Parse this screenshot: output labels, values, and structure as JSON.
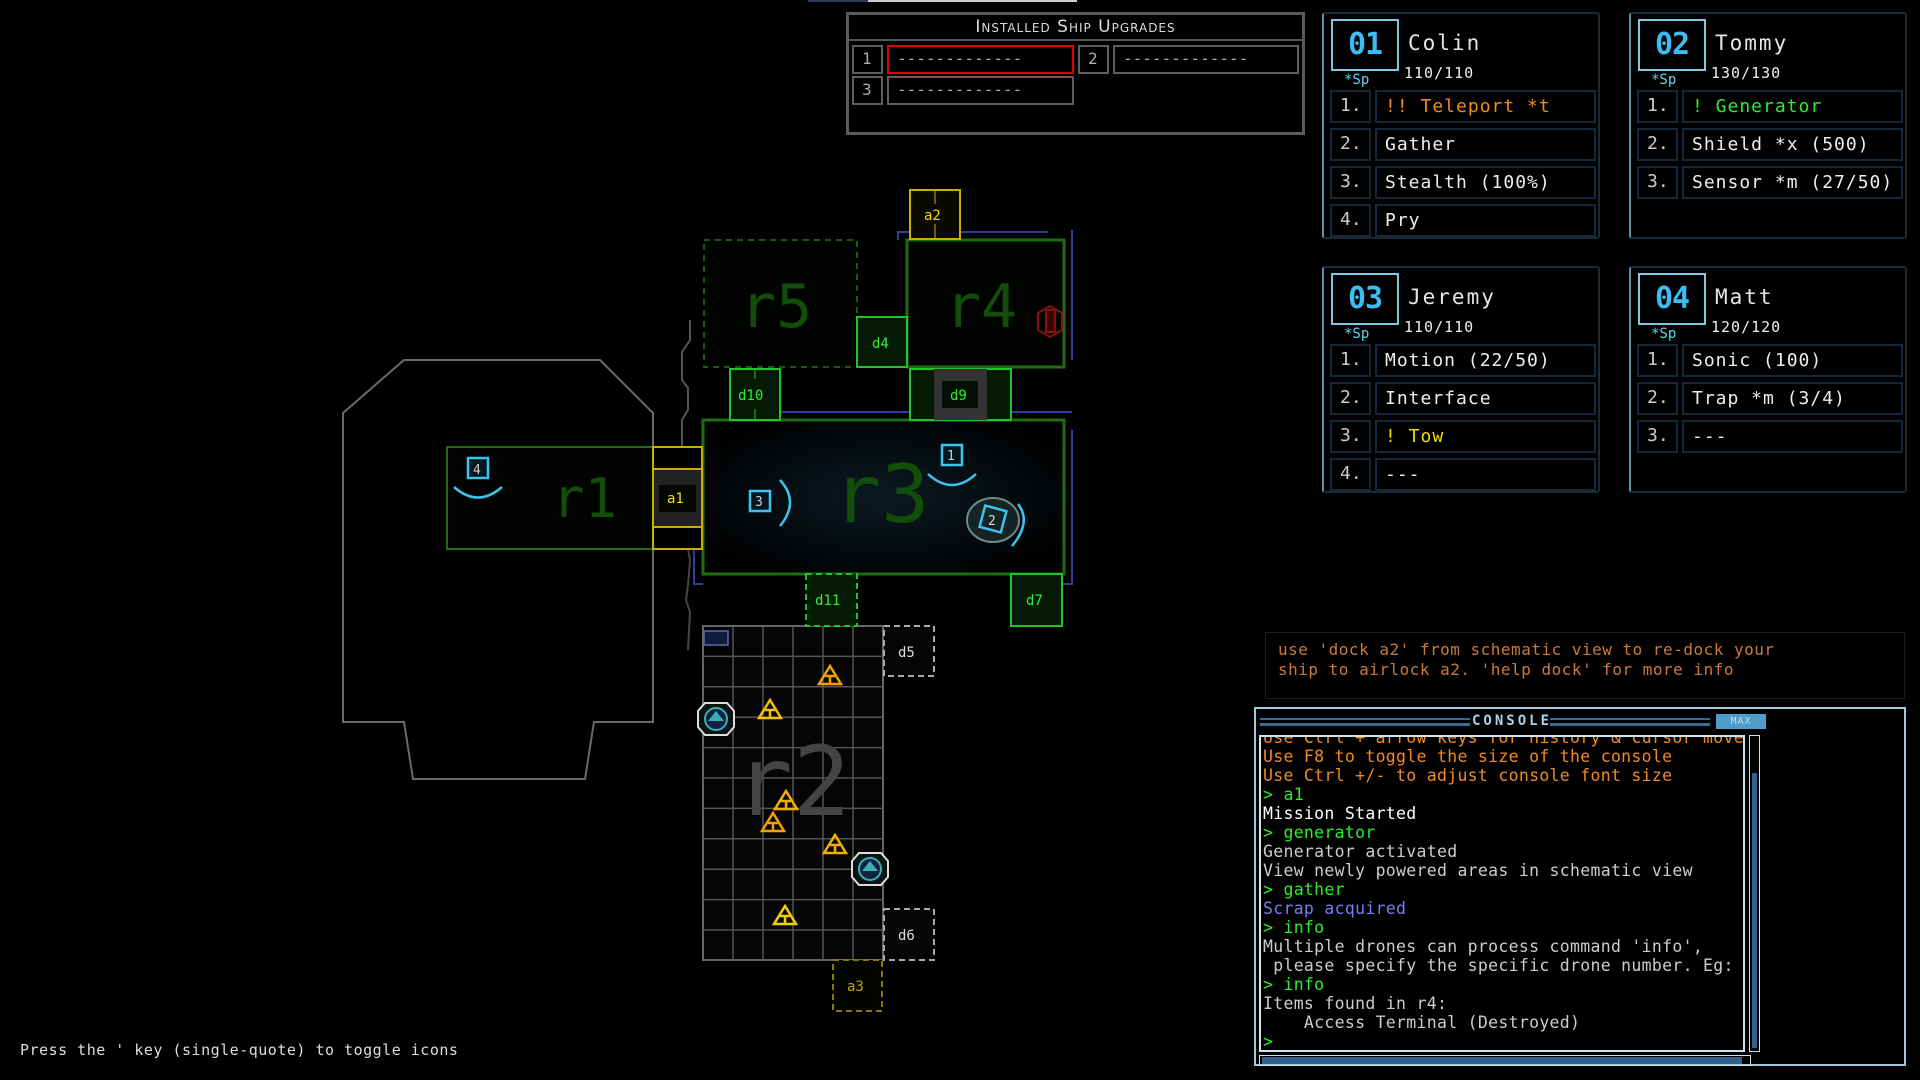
{
  "colors": {
    "room": "#1f6b12",
    "door": "#21c32a",
    "airlock": "#c9b000",
    "drone": "#3cc3f0",
    "hazard": "#f2c200",
    "console_border": "#9ec9dc"
  },
  "map": {
    "rooms": [
      {
        "id": "r1"
      },
      {
        "id": "r2"
      },
      {
        "id": "r3"
      },
      {
        "id": "r4"
      },
      {
        "id": "r5"
      }
    ],
    "doors": [
      "d4",
      "d5",
      "d6",
      "d7",
      "d9",
      "d10",
      "d11"
    ],
    "airlocks": [
      "a1",
      "a2",
      "a3"
    ],
    "drones": [
      "1",
      "2",
      "3",
      "4"
    ],
    "labels": {
      "r1": "r1",
      "r2": "r2",
      "r3": "r3",
      "r4": "r4",
      "r5": "r5",
      "d4": "d4",
      "d5": "d5",
      "d6": "d6",
      "d7": "d7",
      "d9": "d9",
      "d10": "d10",
      "d11": "d11",
      "a1": "a1",
      "a2": "a2",
      "a3": "a3",
      "dr1": "1",
      "dr2": "2",
      "dr3": "3",
      "dr4": "4"
    }
  },
  "upgrades": {
    "title": "Installed Ship Upgrades",
    "slots": [
      {
        "num": "1",
        "value": "-------------"
      },
      {
        "num": "2",
        "value": "-------------"
      },
      {
        "num": "3",
        "value": "-------------"
      }
    ]
  },
  "drones": [
    {
      "badge": "01",
      "name": "Colin",
      "hp": "110/110",
      "tag": "*Sp",
      "skills": [
        {
          "num": "1.",
          "label": "!! Teleport *t"
        },
        {
          "num": "2.",
          "label": "Gather"
        },
        {
          "num": "3.",
          "label": "Stealth (100%)"
        },
        {
          "num": "4.",
          "label": "Pry"
        }
      ]
    },
    {
      "badge": "02",
      "name": "Tommy",
      "hp": "130/130",
      "tag": "*Sp",
      "skills": [
        {
          "num": "1.",
          "label": "! Generator"
        },
        {
          "num": "2.",
          "label": "Shield *x (500)"
        },
        {
          "num": "3.",
          "label": "Sensor *m (27/50)"
        }
      ]
    },
    {
      "badge": "03",
      "name": "Jeremy",
      "hp": "110/110",
      "tag": "*Sp",
      "skills": [
        {
          "num": "1.",
          "label": "Motion (22/50)"
        },
        {
          "num": "2.",
          "label": "Interface"
        },
        {
          "num": "3.",
          "label": "! Tow"
        },
        {
          "num": "4.",
          "label": "---"
        }
      ]
    },
    {
      "badge": "04",
      "name": "Matt",
      "hp": "120/120",
      "tag": "*Sp",
      "skills": [
        {
          "num": "1.",
          "label": "Sonic (100)"
        },
        {
          "num": "2.",
          "label": "Trap *m (3/4)"
        },
        {
          "num": "3.",
          "label": "---"
        }
      ]
    }
  ],
  "hint": {
    "line1": "use 'dock a2' from schematic view to re-dock your",
    "line2": "ship to airlock a2.  'help dock' for more info"
  },
  "console": {
    "title": "CONSOLE",
    "max_label": "MAX",
    "lines": [
      {
        "text": "Use Ctrl + arrow keys for history & cursor movement",
        "kind": "help"
      },
      {
        "text": "Use F8 to toggle the size of the console",
        "kind": "help"
      },
      {
        "text": "Use Ctrl +/- to adjust console font size",
        "kind": "help"
      },
      {
        "text": "> a1",
        "kind": "cmd"
      },
      {
        "text": "Mission Started",
        "kind": "white"
      },
      {
        "text": "> generator",
        "kind": "cmd"
      },
      {
        "text": "Generator activated",
        "kind": "gray"
      },
      {
        "text": "View newly powered areas in schematic view",
        "kind": "gray"
      },
      {
        "text": "> gather",
        "kind": "cmd"
      },
      {
        "text": "Scrap acquired",
        "kind": "blue"
      },
      {
        "text": "> info",
        "kind": "cmd"
      },
      {
        "text": "Multiple drones can process command 'info',",
        "kind": "gray"
      },
      {
        "text": " please specify the specific drone number. Eg: info",
        "kind": "gray"
      },
      {
        "text": "> info",
        "kind": "cmd"
      },
      {
        "text": "Items found in r4:",
        "kind": "gray"
      },
      {
        "text": "    Access Terminal (Destroyed)",
        "kind": "gray"
      },
      {
        "text": ">",
        "kind": "cmd"
      }
    ],
    "input_value": ""
  },
  "footer_hint": "Press the ' key (single-quote) to toggle icons"
}
